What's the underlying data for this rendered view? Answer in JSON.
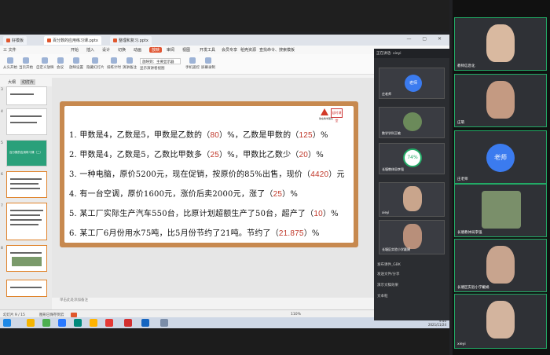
{
  "tabs": [
    {
      "label": "好模板"
    },
    {
      "label": "百分数的应用练习课.pptx"
    },
    {
      "label": "整理和复习.pptx"
    }
  ],
  "menus": [
    "三 文件",
    "开始",
    "插入",
    "设计",
    "切换",
    "动画",
    "放映",
    "审阅",
    "视图",
    "开发工具",
    "会员专享",
    "稻壳资源",
    "查找命令、搜索模板"
  ],
  "menu_highlight": "放映",
  "tools": [
    "从头开始",
    "当页开始",
    "自定义放映",
    "会议",
    "放映设置",
    "隐藏幻灯片",
    "排练计时",
    "演讲备注",
    "手机遥控",
    "屏幕录制"
  ],
  "dropdown_value": "放映到：主要显示器",
  "show_presenter": "显示演讲者视图",
  "thumb_tabs": [
    "大纲",
    "幻灯片"
  ],
  "thumb_numbers": [
    "3",
    "4",
    "5",
    "6",
    "7",
    "8"
  ],
  "thumb_title": "百分数的应用练习课（二）",
  "slide": {
    "logo_text": "徐在教学团队",
    "logo_box": "延时课堂",
    "questions": [
      {
        "pre": "1. 甲数是4，乙数是5，甲数是乙数的（",
        "a1": "80",
        "mid": "）%，乙数是甲数的（",
        "a2": "125",
        "post": "）%"
      },
      {
        "pre": "2. 甲数是4，乙数是5，乙数比甲数多（",
        "a1": "25",
        "mid": "）%，甲数比乙数少（",
        "a2": "20",
        "post": "）%"
      },
      {
        "pre": "3. 一种电脑，原价5200元，现在促销，按原价的85%出售，现价（",
        "a1": "4420",
        "mid": "）元",
        "a2": "",
        "post": ""
      },
      {
        "pre": "4. 有一台空调，原价1600元，涨价后卖2000元，涨了（",
        "a1": "25",
        "mid": "）%",
        "a2": "",
        "post": ""
      },
      {
        "pre": "5. 某工厂实际生产汽车550台，比原计划超额生产了50台，超产了（",
        "a1": "10",
        "mid": "）%",
        "a2": "",
        "post": ""
      },
      {
        "pre": "6. 某工厂6月份用水75吨，比5月份节约了21吨。节约了（",
        "a1": "21.875",
        "mid": "）%",
        "a2": "",
        "post": ""
      }
    ]
  },
  "notes_placeholder": "单击此处添加备注",
  "status": {
    "page": "幻灯片 9 / 15",
    "doc": "图形已保存到云",
    "zoom": "110%"
  },
  "panel": {
    "header": "正在讲话: xieyi",
    "tiles": [
      {
        "name": "庄老师",
        "avatar": "老师"
      },
      {
        "name": "数学学科王敏"
      },
      {
        "name": "长塘教体局李强",
        "badge": "74%"
      },
      {
        "name": "xieyi"
      },
      {
        "name": "长塘区实验小学戴娟"
      }
    ],
    "menu": [
      "发布课件_GBK",
      "发送文件/分享",
      "演示文稿效果",
      "文本框"
    ]
  },
  "gallery": [
    {
      "name": "教师信息化",
      "type": "face"
    },
    {
      "name": "庄萌",
      "type": "face"
    },
    {
      "name": "庄老师",
      "type": "avatar",
      "avatar": "老师"
    },
    {
      "name": "长塘教体局李强",
      "type": "face"
    },
    {
      "name": "长塘区实验小学戴娟",
      "type": "face"
    },
    {
      "name": "xieyi",
      "type": "face"
    }
  ],
  "tray_time": "9:40",
  "tray_date": "2021/11/24"
}
